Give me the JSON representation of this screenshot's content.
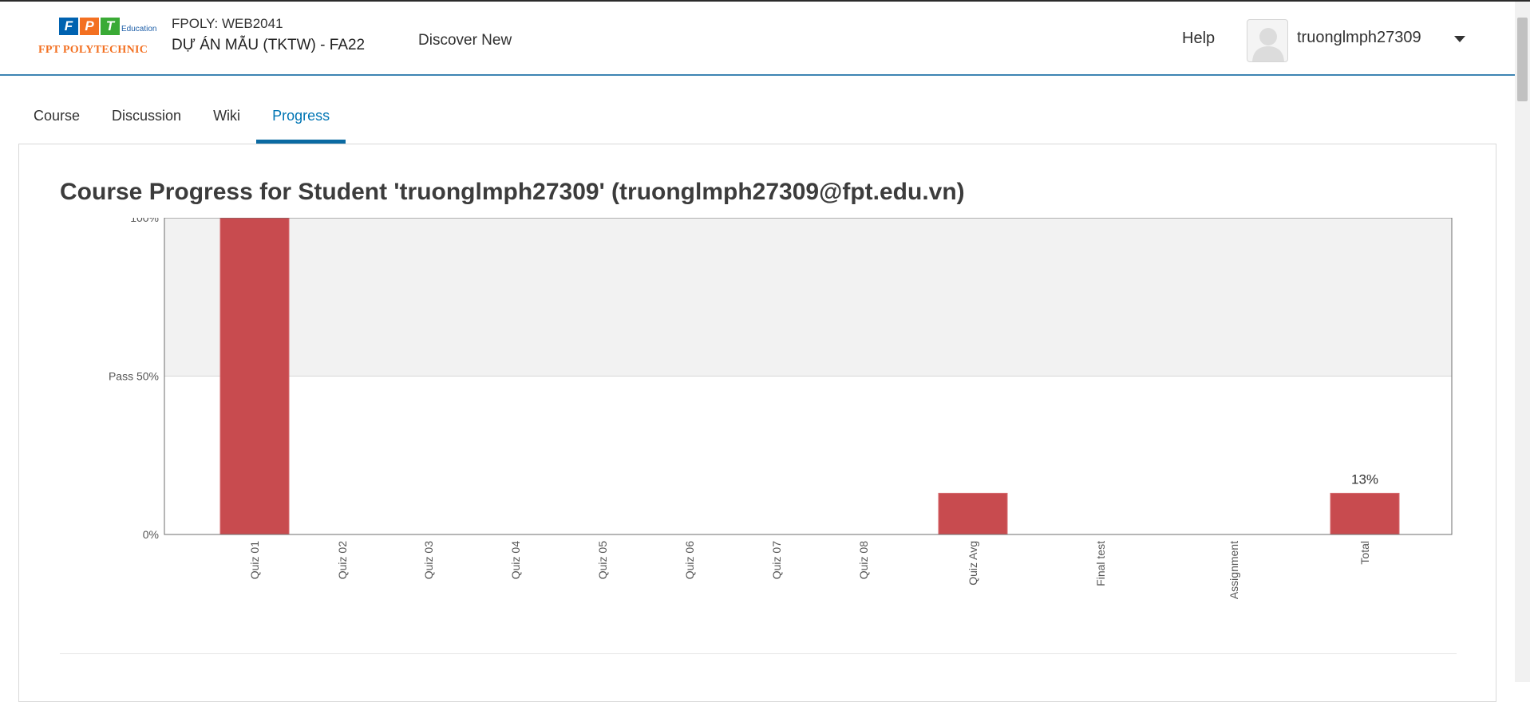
{
  "header": {
    "logo": {
      "letters": [
        "F",
        "P",
        "T"
      ],
      "education": "Education",
      "polytechnic": "FPT POLYTECHNIC",
      "colors": [
        "#0062b0",
        "#f37021",
        "#3aaa35"
      ]
    },
    "course_code": "FPOLY: WEB2041",
    "course_name": "DỰ ÁN MẪU (TKTW) - FA22",
    "discover": "Discover New",
    "help": "Help",
    "username": "truonglmph27309"
  },
  "tabs": [
    {
      "label": "Course",
      "active": false
    },
    {
      "label": "Discussion",
      "active": false
    },
    {
      "label": "Wiki",
      "active": false
    },
    {
      "label": "Progress",
      "active": true
    }
  ],
  "main": {
    "title": "Course Progress for Student 'truonglmph27309' (truonglmph27309@fpt.edu.vn)"
  },
  "chart_data": {
    "type": "bar",
    "categories": [
      "Quiz 01",
      "Quiz 02",
      "Quiz 03",
      "Quiz 04",
      "Quiz 05",
      "Quiz 06",
      "Quiz 07",
      "Quiz 08",
      "Quiz Avg",
      "Final test",
      "Assignment",
      "Total"
    ],
    "values": [
      100,
      0,
      0,
      0,
      0,
      0,
      0,
      0,
      13,
      0,
      0,
      13
    ],
    "ylim": [
      0,
      100
    ],
    "yticks": [
      {
        "value": 100,
        "label": "100%"
      },
      {
        "value": 50,
        "label": "Pass 50%"
      },
      {
        "value": 0,
        "label": "0%"
      }
    ],
    "pass_threshold": 50,
    "annotations": [
      {
        "category": "Total",
        "text": "13%"
      }
    ],
    "bar_color": "#c84b4f",
    "pass_zone_color": "#f2f2f2",
    "grid": false
  }
}
